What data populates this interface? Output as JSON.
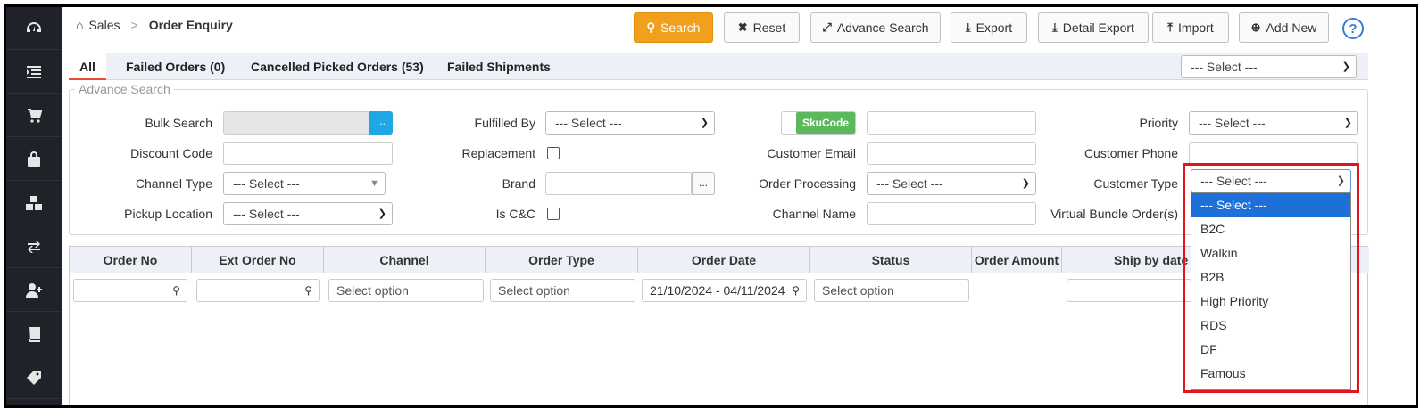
{
  "sidebar": {
    "icons": [
      "dashboard-icon",
      "list-indent-icon",
      "cart-icon",
      "bag-icon",
      "cubes-icon",
      "exchange-icon",
      "user-plus-icon",
      "book-icon",
      "tag-icon"
    ]
  },
  "breadcrumb": {
    "home": "Sales",
    "separator": ">",
    "current": "Order Enquiry"
  },
  "toolbar": {
    "search": "Search",
    "reset": "Reset",
    "advance_search": "Advance Search",
    "export": "Export",
    "detail_export": "Detail Export",
    "import": "Import",
    "add_new": "Add New",
    "help": "?"
  },
  "tabs": [
    "All",
    "Failed Orders (0)",
    "Cancelled Picked Orders (53)",
    "Failed Shipments"
  ],
  "tab_select": "--- Select ---",
  "advance_search": {
    "legend": "Advance Search",
    "bulk_search": "Bulk Search",
    "discount_code": "Discount Code",
    "channel_type": "Channel Type",
    "pickup_location": "Pickup Location",
    "fulfilled_by": "Fulfilled By",
    "replacement": "Replacement",
    "brand": "Brand",
    "is_cc": "Is C&C",
    "sku_code": "SkuCode",
    "customer_email": "Customer Email",
    "order_processing": "Order Processing",
    "channel_name": "Channel Name",
    "priority": "Priority",
    "customer_phone": "Customer Phone",
    "customer_type": "Customer Type",
    "virtual_bundle": "Virtual Bundle Order(s)",
    "select_placeholder": "--- Select ---",
    "dots": "..."
  },
  "grid": {
    "headers": [
      "Order No",
      "Ext Order No",
      "Channel",
      "Order Type",
      "Order Date",
      "Status",
      "Order Amount",
      "Ship by date"
    ],
    "select_option": "Select option",
    "date_range": "21/10/2024 - 04/11/2024"
  },
  "customer_type_dropdown": {
    "selected": "--- Select ---",
    "options": [
      "--- Select ---",
      "B2C",
      "Walkin",
      "B2B",
      "High Priority",
      "RDS",
      "DF",
      "Famous"
    ],
    "highlight_color": "#e0161e"
  },
  "colors": {
    "sidebar": "#1f2329",
    "search_button": "#f0a01c",
    "sku_toggle": "#5cb85c",
    "active_tab": "#e94b2e"
  }
}
